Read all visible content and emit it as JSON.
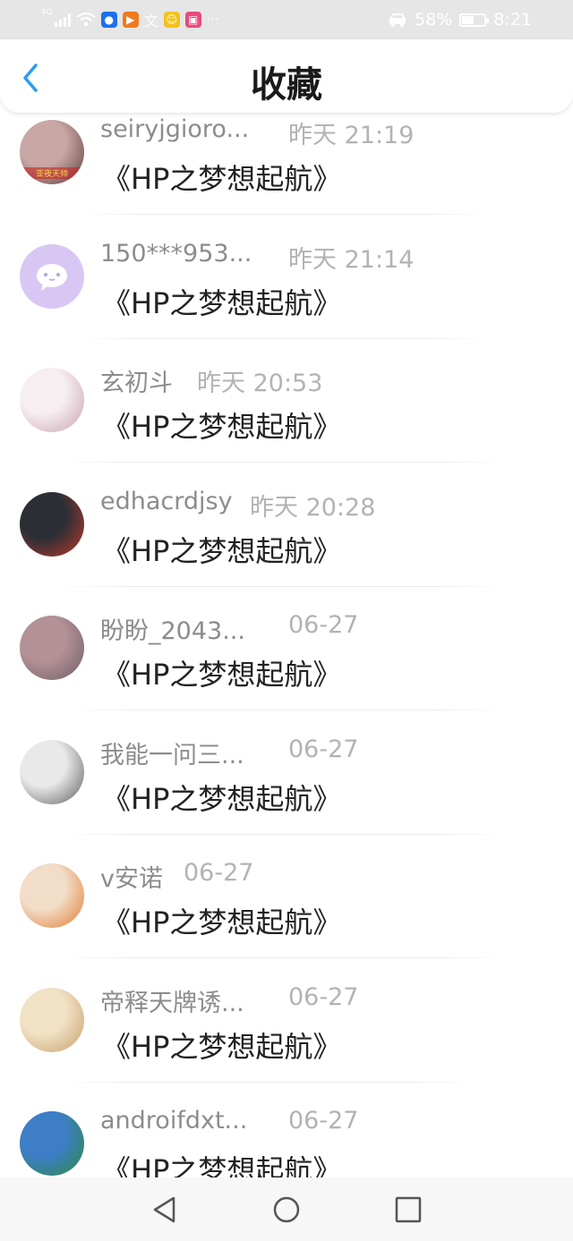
{
  "status_bar": {
    "network": "4G",
    "battery_text": "58%",
    "battery_level": 0.58,
    "time": "8:21",
    "more": "···"
  },
  "header": {
    "title": "收藏"
  },
  "items": [
    {
      "name": "seiryjgioro...",
      "time": "昨天 21:19",
      "content": "《HP之梦想起航》",
      "avatar_colors": [
        "#c9a7a4",
        "#5a3a3a"
      ],
      "badge": "亚夜天帅"
    },
    {
      "name": "150***953...",
      "time": "昨天 21:14",
      "content": "《HP之梦想起航》",
      "avatar_colors": [
        "#d8c7f3",
        "#d8c7f3"
      ]
    },
    {
      "name": "玄初斗",
      "time": "昨天 20:53",
      "content": "《HP之梦想起航》",
      "avatar_colors": [
        "#f6eef0",
        "#c9a0ae"
      ]
    },
    {
      "name": "edhacrdjsy",
      "time": "昨天 20:28",
      "content": "《HP之梦想起航》",
      "avatar_colors": [
        "#2b2f35",
        "#c0392b"
      ]
    },
    {
      "name": "盼盼_2043...",
      "time": "06-27",
      "content": "《HP之梦想起航》",
      "avatar_colors": [
        "#b39196",
        "#6d5d66"
      ]
    },
    {
      "name": "我能一问三...",
      "time": "06-27",
      "content": "《HP之梦想起航》",
      "avatar_colors": [
        "#e9e9e9",
        "#5c5c5c"
      ]
    },
    {
      "name": "v安诺",
      "time": "06-27",
      "content": "《HP之梦想起航》",
      "avatar_colors": [
        "#f2ddc8",
        "#e07a2c"
      ]
    },
    {
      "name": "帝释天牌诱...",
      "time": "06-27",
      "content": "《HP之梦想起航》",
      "avatar_colors": [
        "#f1e2c6",
        "#c89d6a"
      ]
    },
    {
      "name": "androifdxt...",
      "time": "06-27",
      "content": "《HP之梦想起航》",
      "avatar_colors": [
        "#3d7ec6",
        "#2e8b3e"
      ]
    }
  ],
  "colors": {
    "accent": "#2a9df4",
    "status_bar_bg": "#e6e6e6"
  },
  "nav_icons": [
    "back-triangle-icon",
    "home-circle-icon",
    "recents-square-icon"
  ]
}
